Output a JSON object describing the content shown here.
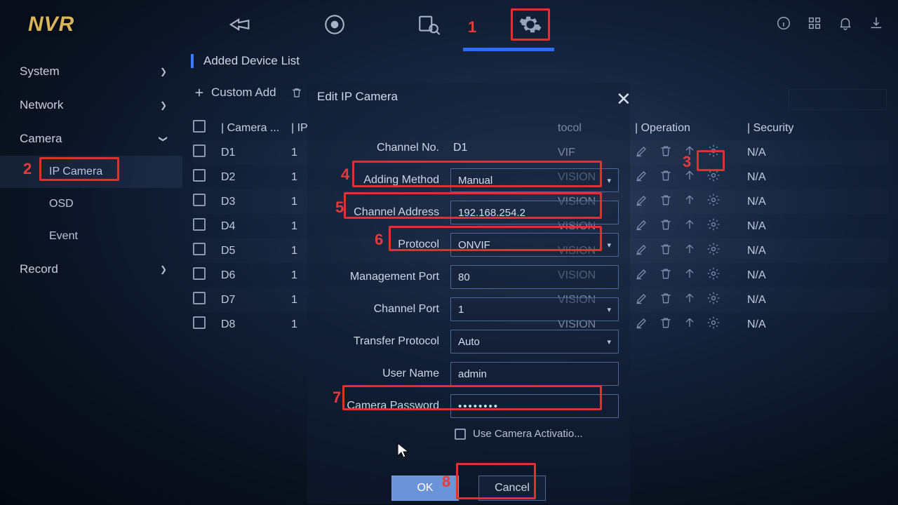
{
  "logo": "NVR",
  "top_nav": {
    "items": [
      "live-icon",
      "playback-icon",
      "search-icon",
      "settings-icon"
    ]
  },
  "annotations": {
    "n1": "1",
    "n2": "2",
    "n3": "3",
    "n4": "4",
    "n5": "5",
    "n6": "6",
    "n7": "7",
    "n8": "8"
  },
  "sidebar": {
    "items": [
      {
        "label": "System",
        "expandable": true
      },
      {
        "label": "Network",
        "expandable": true
      },
      {
        "label": "Camera",
        "expandable": true,
        "expanded": true,
        "children": [
          {
            "label": "IP Camera"
          },
          {
            "label": "OSD"
          },
          {
            "label": "Event"
          }
        ]
      },
      {
        "label": "Record",
        "expandable": true
      }
    ]
  },
  "page_title": "Added Device List",
  "toolbar": {
    "custom_add": "Custom Add",
    "delete": ""
  },
  "table": {
    "columns": [
      "",
      "Camera ...",
      "IP",
      "tocol",
      "Operation",
      "Security"
    ],
    "col_sep_camera": "|  Camera ...",
    "col_ip": "|  IP",
    "col_protocol": "tocol",
    "col_operation": "|  Operation",
    "col_security": "|  Security",
    "rows": [
      {
        "ch": "D1",
        "ip": "1",
        "protocol": "VIF",
        "security": "N/A"
      },
      {
        "ch": "D2",
        "ip": "1",
        "protocol": "VISION",
        "security": "N/A"
      },
      {
        "ch": "D3",
        "ip": "1",
        "protocol": "VISION",
        "security": "N/A"
      },
      {
        "ch": "D4",
        "ip": "1",
        "protocol": "VISION",
        "security": "N/A"
      },
      {
        "ch": "D5",
        "ip": "1",
        "protocol": "VISION",
        "security": "N/A"
      },
      {
        "ch": "D6",
        "ip": "1",
        "protocol": "VISION",
        "security": "N/A"
      },
      {
        "ch": "D7",
        "ip": "1",
        "protocol": "VISION",
        "security": "N/A"
      },
      {
        "ch": "D8",
        "ip": "1",
        "protocol": "VISION",
        "security": "N/A"
      }
    ]
  },
  "modal": {
    "title": "Edit IP Camera",
    "channel_no_label": "Channel No.",
    "channel_no_value": "D1",
    "adding_method_label": "Adding Method",
    "adding_method_value": "Manual",
    "channel_address_label": "Channel Address",
    "channel_address_value": "192.168.254.2",
    "protocol_label": "Protocol",
    "protocol_value": "ONVIF",
    "management_port_label": "Management Port",
    "management_port_value": "80",
    "channel_port_label": "Channel Port",
    "channel_port_value": "1",
    "transfer_protocol_label": "Transfer Protocol",
    "transfer_protocol_value": "Auto",
    "username_label": "User Name",
    "username_value": "admin",
    "password_label": "Camera Password",
    "password_value": "••••••••",
    "use_activation_label": "Use Camera Activatio...",
    "ok": "OK",
    "cancel": "Cancel"
  }
}
